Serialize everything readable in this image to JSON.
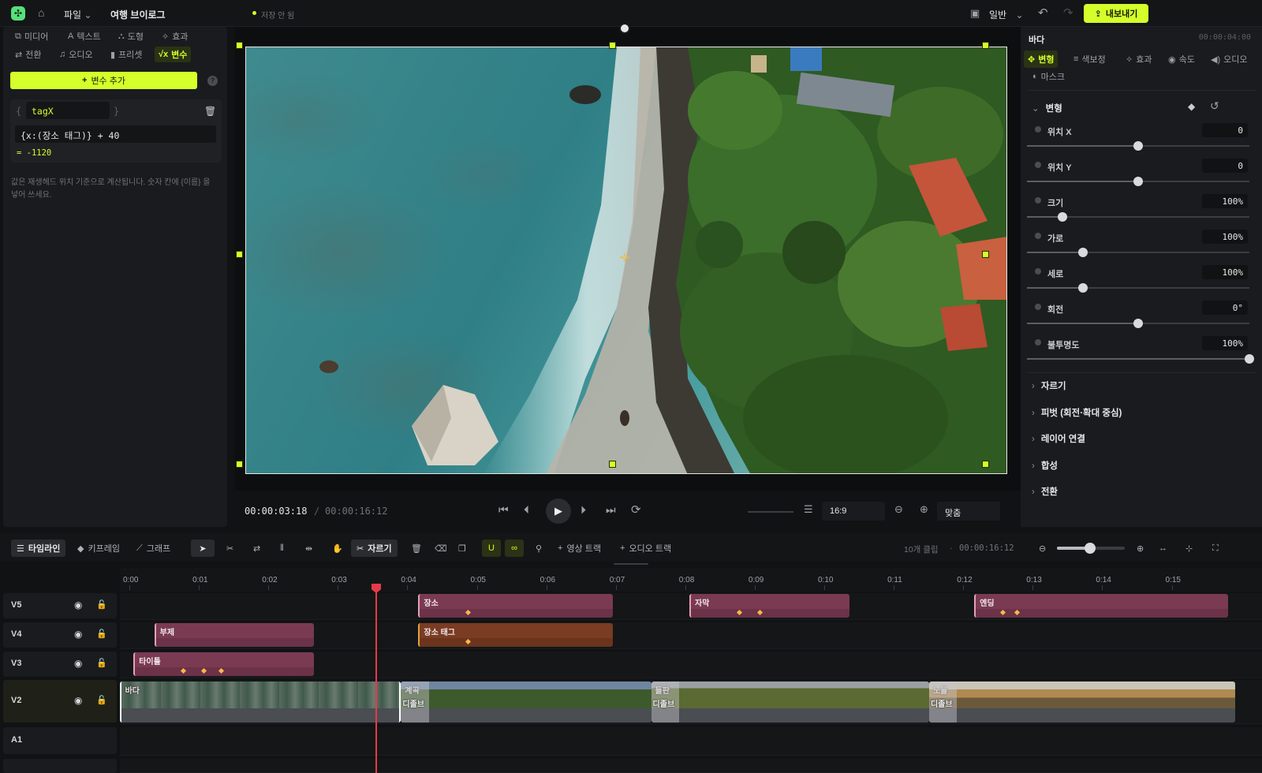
{
  "topbar": {
    "file_menu": "파일",
    "project_name": "여행 브이로그",
    "save_status": "저장 안 됨",
    "quality": "일반",
    "export_label": "내보내기"
  },
  "left": {
    "tabs": [
      "미디어",
      "텍스트",
      "도형",
      "효과",
      "전환",
      "오디오",
      "프리셋",
      "변수"
    ],
    "add_variable": "변수 추가",
    "variable": {
      "name": "tagX",
      "expression": "{x:(장소 태그)} + 40",
      "result": "= -1120"
    },
    "hint": "값은 재생헤드 위치 기준으로 계산됩니다. 숫자 칸에 {이름} 을 넣어 쓰세요."
  },
  "transport": {
    "current_time": "00:00:03:18",
    "separator": "/",
    "total_time": "00:00:16:12",
    "aspect": "16:9",
    "zoom_fit": "맞춤"
  },
  "right": {
    "clip_name": "바다",
    "clip_time": "00:00:04:00",
    "tabs": [
      "변형",
      "색보정",
      "효과",
      "속도",
      "오디오",
      "마스크"
    ],
    "transform_title": "변형",
    "properties": [
      {
        "label": "위치 X",
        "value": "0",
        "level": 0.5
      },
      {
        "label": "위치 Y",
        "value": "0",
        "level": 0.5
      },
      {
        "label": "크기",
        "value": "100%",
        "level": 0.16
      },
      {
        "label": "가로",
        "value": "100%",
        "level": 0.25
      },
      {
        "label": "세로",
        "value": "100%",
        "level": 0.25
      },
      {
        "label": "회전",
        "value": "0°",
        "level": 0.5
      },
      {
        "label": "불투명도",
        "value": "100%",
        "level": 1.0
      }
    ],
    "sections": [
      "자르기",
      "피벗 (회전·확대 중심)",
      "레이어 연결",
      "합성",
      "전환"
    ]
  },
  "timeline": {
    "tabs": [
      "타임라인",
      "키프레임",
      "그래프"
    ],
    "cut_label": "자르기",
    "add_video_track": "영상 트랙",
    "add_audio_track": "오디오 트랙",
    "clip_count": "10개 클립",
    "dot": "·",
    "duration": "00:00:16:12",
    "ruler": [
      "0:00",
      "0:01",
      "0:02",
      "0:03",
      "0:04",
      "0:05",
      "0:06",
      "0:07",
      "0:08",
      "0:09",
      "0:10",
      "0:11",
      "0:12",
      "0:13",
      "0:14",
      "0:15"
    ],
    "tracks": [
      "V5",
      "V4",
      "V3",
      "V2",
      "A1"
    ],
    "clips": {
      "place": "장소",
      "subtitle": "자막",
      "ending": "엔딩",
      "subhead": "부제",
      "place_tag": "장소 태그",
      "title": "타이틀",
      "sea": "바다",
      "valley": "계곡",
      "field": "들판",
      "sunset": "노을",
      "dissolve": "디졸브"
    }
  },
  "colors": {
    "accent": "#d4ff2a",
    "playhead": "#e63a4a",
    "text_clip": "#7a3a52",
    "tag_clip": "#7a3c22"
  }
}
